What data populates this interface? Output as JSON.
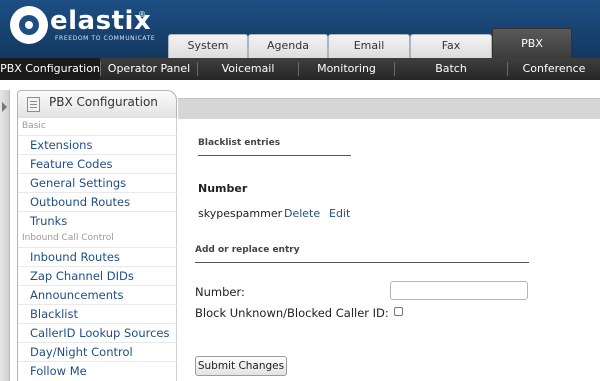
{
  "brand": {
    "name": "elastix",
    "registered": "®",
    "tagline": "FREEDOM TO COMMUNICATE",
    "brand_color": "#1d4f84"
  },
  "top_tabs": [
    {
      "label": "System",
      "active": false
    },
    {
      "label": "Agenda",
      "active": false
    },
    {
      "label": "Email",
      "active": false
    },
    {
      "label": "Fax",
      "active": false
    },
    {
      "label": "PBX",
      "active": true
    }
  ],
  "menu": [
    {
      "label": "PBX Configuration",
      "active": true
    },
    {
      "label": "Operator Panel",
      "active": false
    },
    {
      "label": "Voicemail",
      "active": false
    },
    {
      "label": "Monitoring",
      "active": false
    },
    {
      "label": "Batch Configurations",
      "active": false
    },
    {
      "label": "Conference",
      "active": false
    }
  ],
  "module": {
    "title": "PBX Configuration",
    "icon": "document-icon"
  },
  "sidebar": {
    "group_basic": "Basic",
    "group_inbound": "Inbound Call Control",
    "items": [
      "Extensions",
      "Feature Codes",
      "General Settings",
      "Outbound Routes",
      "Trunks",
      "Inbound Routes",
      "Zap Channel DIDs",
      "Announcements",
      "Blacklist",
      "CallerID Lookup Sources",
      "Day/Night Control",
      "Follow Me"
    ]
  },
  "content": {
    "blacklist_title": "Blacklist entries",
    "number_header": "Number",
    "entries": [
      {
        "number": "skypespammer",
        "delete_label": "Delete",
        "edit_label": "Edit"
      }
    ],
    "form_title": "Add or replace entry",
    "number_label": "Number:",
    "number_value": "",
    "block_label": "Block Unknown/Blocked Caller ID:",
    "block_checked": false,
    "submit_label": "Submit Changes"
  }
}
